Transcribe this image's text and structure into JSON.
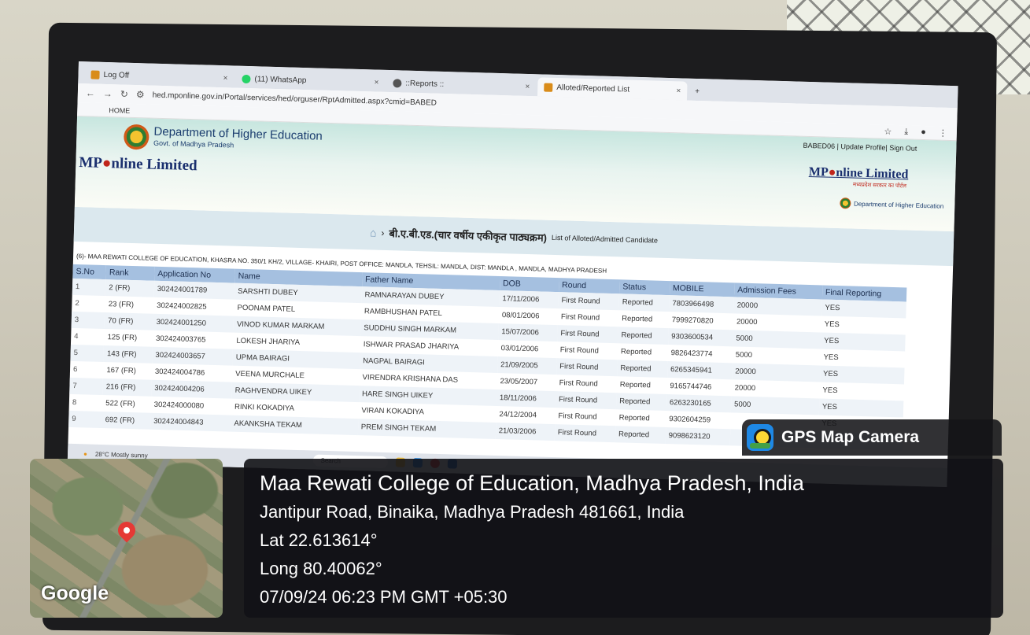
{
  "browser": {
    "tabs": [
      {
        "label": "Log Off",
        "color": "#d98c1a"
      },
      {
        "label": "(11) WhatsApp",
        "color": "#25d366"
      },
      {
        "label": "::Reports ::",
        "color": "#555555"
      },
      {
        "label": "Alloted/Reported List",
        "color": "#d98c1a"
      }
    ],
    "new_tab": "+",
    "url": "hed.mponline.gov.in/Portal/services/hed/orguser/RptAdmitted.aspx?cmid=BABED",
    "bookmark_home": "HOME"
  },
  "header": {
    "dept_title": "Department of Higher Education",
    "dept_sub": "Govt. of Madhya Pradesh",
    "mp_brand_prefix": "MP",
    "mp_brand_rest": "nline Limited",
    "user_links": "BABED06 | Update Profile| Sign Out",
    "mp_right_sub": "मध्यप्रदेश सरकार का पोर्टल",
    "dhe_right": "Department of Higher Education"
  },
  "crumb": {
    "hindi": "बी.ए.बी.एड.(चार वर्षीय एकीकृत पाठ्यक्रम)",
    "english": "List of Alloted/Admitted Candidate"
  },
  "college_line": "(6)- MAA REWATI COLLEGE OF EDUCATION, KHASRA NO. 350/1 KH/2, VILLAGE- KHAIRI, POST OFFICE: MANDLA, TEHSIL: MANDLA, DIST: MANDLA , MANDLA, MADHYA PRADESH",
  "table": {
    "headers": [
      "S.No",
      "Rank",
      "Application No",
      "Name",
      "Father Name",
      "DOB",
      "Round",
      "Status",
      "MOBILE",
      "Admission Fees",
      "Final Reporting"
    ],
    "rows": [
      [
        "1",
        "2 (FR)",
        "302424001789",
        "SARSHTI DUBEY",
        "RAMNARAYAN DUBEY",
        "17/11/2006",
        "First Round",
        "Reported",
        "7803966498",
        "20000",
        "YES"
      ],
      [
        "2",
        "23 (FR)",
        "302424002825",
        "POONAM PATEL",
        "RAMBHUSHAN PATEL",
        "08/01/2006",
        "First Round",
        "Reported",
        "7999270820",
        "20000",
        "YES"
      ],
      [
        "3",
        "70 (FR)",
        "302424001250",
        "VINOD KUMAR MARKAM",
        "SUDDHU SINGH MARKAM",
        "15/07/2006",
        "First Round",
        "Reported",
        "9303600534",
        "5000",
        "YES"
      ],
      [
        "4",
        "125 (FR)",
        "302424003765",
        "LOKESH JHARIYA",
        "ISHWAR PRASAD JHARIYA",
        "03/01/2006",
        "First Round",
        "Reported",
        "9826423774",
        "5000",
        "YES"
      ],
      [
        "5",
        "143 (FR)",
        "302424003657",
        "UPMA BAIRAGI",
        "NAGPAL BAIRAGI",
        "21/09/2005",
        "First Round",
        "Reported",
        "6265345941",
        "20000",
        "YES"
      ],
      [
        "6",
        "167 (FR)",
        "302424004786",
        "VEENA MURCHALE",
        "VIRENDRA KRISHANA DAS",
        "23/05/2007",
        "First Round",
        "Reported",
        "9165744746",
        "20000",
        "YES"
      ],
      [
        "7",
        "216 (FR)",
        "302424004206",
        "RAGHVENDRA UIKEY",
        "HARE SINGH UIKEY",
        "18/11/2006",
        "First Round",
        "Reported",
        "6263230165",
        "5000",
        "YES"
      ],
      [
        "8",
        "522 (FR)",
        "302424000080",
        "RINKI KOKADIYA",
        "VIRAN KOKADIYA",
        "24/12/2004",
        "First Round",
        "Reported",
        "9302604259",
        "",
        "YES"
      ],
      [
        "9",
        "692 (FR)",
        "302424004843",
        "AKANKSHA TEKAM",
        "PREM SINGH TEKAM",
        "21/03/2006",
        "First Round",
        "Reported",
        "9098623120",
        "",
        ""
      ]
    ]
  },
  "taskbar": {
    "weather_temp": "28°C",
    "weather_desc": "Mostly sunny",
    "search": "Search"
  },
  "gps": {
    "badge_title": "GPS Map Camera",
    "place": "Maa Rewati College of Education, Madhya Pradesh, India",
    "address": "Jantipur Road, Binaika, Madhya Pradesh 481661, India",
    "lat": "Lat 22.613614°",
    "long": "Long 80.40062°",
    "datetime": "07/09/24 06:23 PM GMT +05:30",
    "map_label": "Google"
  }
}
